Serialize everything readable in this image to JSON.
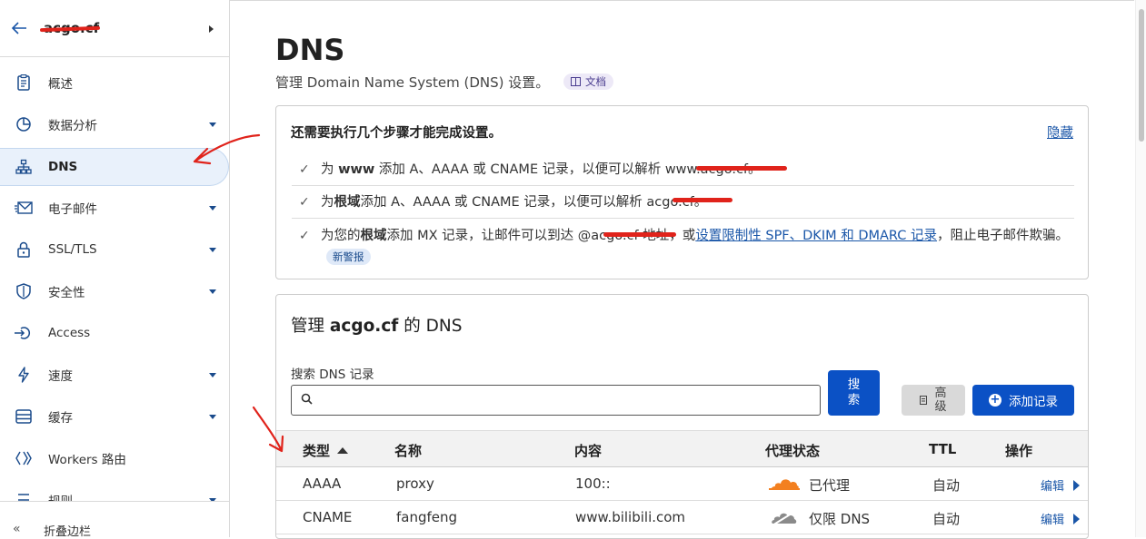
{
  "sidebar": {
    "domain": "acgo.cf",
    "items": [
      {
        "label": "概述",
        "dropdown": false,
        "icon": "clipboard-icon"
      },
      {
        "label": "数据分析",
        "dropdown": true,
        "icon": "pie-chart-icon"
      },
      {
        "label": "DNS",
        "dropdown": false,
        "icon": "dns-tree-icon",
        "active": true
      },
      {
        "label": "电子邮件",
        "dropdown": true,
        "icon": "email-icon"
      },
      {
        "label": "SSL/TLS",
        "dropdown": true,
        "icon": "lock-icon"
      },
      {
        "label": "安全性",
        "dropdown": true,
        "icon": "shield-icon"
      },
      {
        "label": "Access",
        "dropdown": false,
        "icon": "access-icon"
      },
      {
        "label": "速度",
        "dropdown": true,
        "icon": "lightning-icon"
      },
      {
        "label": "缓存",
        "dropdown": true,
        "icon": "cache-icon"
      },
      {
        "label": "Workers 路由",
        "dropdown": false,
        "icon": "workers-icon"
      },
      {
        "label": "规则",
        "dropdown": true,
        "icon": "rules-icon"
      }
    ],
    "collapse_label": "折叠边栏"
  },
  "page": {
    "title": "DNS",
    "subtitle": "管理 Domain Name System (DNS) 设置。",
    "doc_badge": "文档"
  },
  "steps": {
    "title": "还需要执行几个步骤才能完成设置。",
    "hide": "隐藏",
    "items": [
      {
        "pre": "为 ",
        "bold": "www",
        "post": " 添加 A、AAAA 或 CNAME 记录，以便可以解析 www.acgo.cf。"
      },
      {
        "pre": "为",
        "bold": "根域",
        "post": "添加 A、AAAA 或 CNAME 记录，以便可以解析 acgo.cf。"
      },
      {
        "pre": "为您的",
        "bold": "根域",
        "post": "添加 MX 记录，让邮件可以到达 @acgo.cf 地址，或",
        "link": "设置限制性 SPF、DKIM 和 DMARC 记录",
        "post2": "，阻止电子邮件欺骗。",
        "badge": "新警报"
      }
    ]
  },
  "manage": {
    "title_pre": "管理 ",
    "title_domain": "acgo.cf",
    "title_post": " 的 DNS",
    "search_label": "搜索 DNS 记录",
    "search_placeholder": "",
    "search_button": "搜\n索",
    "advanced_button": "高\n级",
    "add_button": "添加记录",
    "columns": [
      "类型",
      "名称",
      "内容",
      "代理状态",
      "TTL",
      "操作"
    ],
    "rows": [
      {
        "type": "AAAA",
        "name": "proxy",
        "content": "100::",
        "proxy": "已代理",
        "proxied": true,
        "ttl": "自动",
        "action": "编辑"
      },
      {
        "type": "CNAME",
        "name": "fangfeng",
        "content": "www.bilibili.com",
        "proxy": "仅限 DNS",
        "proxied": false,
        "ttl": "自动",
        "action": "编辑"
      }
    ]
  },
  "colors": {
    "accent": "#0b51c5",
    "link": "#1a56a8",
    "proxy_orange": "#f38020",
    "annotation_red": "#e0231b"
  }
}
